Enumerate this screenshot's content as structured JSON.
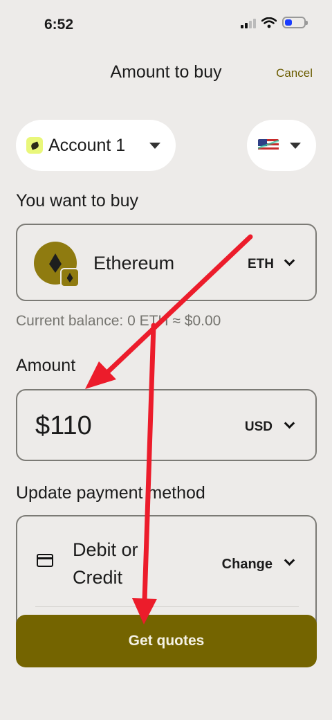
{
  "status_bar": {
    "time": "6:52"
  },
  "header": {
    "title": "Amount to buy",
    "cancel_label": "Cancel"
  },
  "account_selector": {
    "name": "Account 1"
  },
  "region_selector": {
    "flag_icon": "us-flag-icon"
  },
  "buy_section": {
    "label": "You want to buy",
    "token_name": "Ethereum",
    "token_symbol": "ETH",
    "balance_text": "Current balance: 0 ETH ≈ $0.00"
  },
  "amount_section": {
    "label": "Amount",
    "value": "$110",
    "currency": "USD"
  },
  "payment_section": {
    "label": "Update payment method",
    "method_name": "Debit or Credit",
    "change_label": "Change"
  },
  "primary_action": {
    "label": "Get quotes"
  },
  "colors": {
    "background": "#edebe9",
    "accent": "#746400",
    "annotation": "#ec1c2b"
  }
}
